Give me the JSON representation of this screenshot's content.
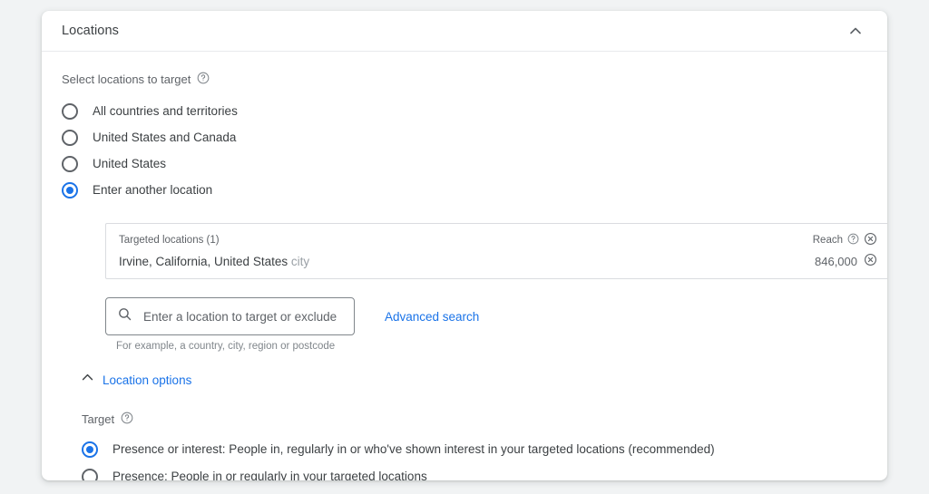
{
  "card": {
    "title": "Locations",
    "collapse_icon": "chevron-up-icon"
  },
  "select_locations": {
    "label": "Select locations to target",
    "help_icon": "help-circle-icon",
    "options": [
      {
        "label": "All countries and territories",
        "selected": false
      },
      {
        "label": "United States and Canada",
        "selected": false
      },
      {
        "label": "United States",
        "selected": false
      },
      {
        "label": "Enter another location",
        "selected": true
      }
    ]
  },
  "targeted_locations": {
    "header_left": "Targeted locations (1)",
    "header_reach": "Reach",
    "header_help_icon": "help-circle-icon",
    "header_remove_icon": "remove-circle-icon",
    "rows": [
      {
        "name": "Irvine, California, United States",
        "type": "city",
        "reach": "846,000",
        "remove_icon": "remove-circle-icon"
      }
    ]
  },
  "search": {
    "icon": "search-icon",
    "placeholder": "Enter a location to target or exclude",
    "value": "",
    "hint": "For example, a country, city, region or postcode",
    "advanced_link": "Advanced search"
  },
  "location_options": {
    "label": "Location options",
    "toggle_icon": "chevron-up-icon",
    "expanded": true
  },
  "target": {
    "label": "Target",
    "help_icon": "help-circle-icon",
    "options": [
      {
        "label": "Presence or interest: People in, regularly in or who've shown interest in your targeted locations (recommended)",
        "selected": true
      },
      {
        "label": "Presence: People in or regularly in your targeted locations",
        "selected": false
      }
    ]
  },
  "colors": {
    "accent": "#1a73e8",
    "text_primary": "#3c4043",
    "text_secondary": "#5f6368",
    "text_muted": "#9aa0a6",
    "border": "#dadce0",
    "page_bg": "#f1f3f4",
    "card_bg": "#ffffff"
  }
}
